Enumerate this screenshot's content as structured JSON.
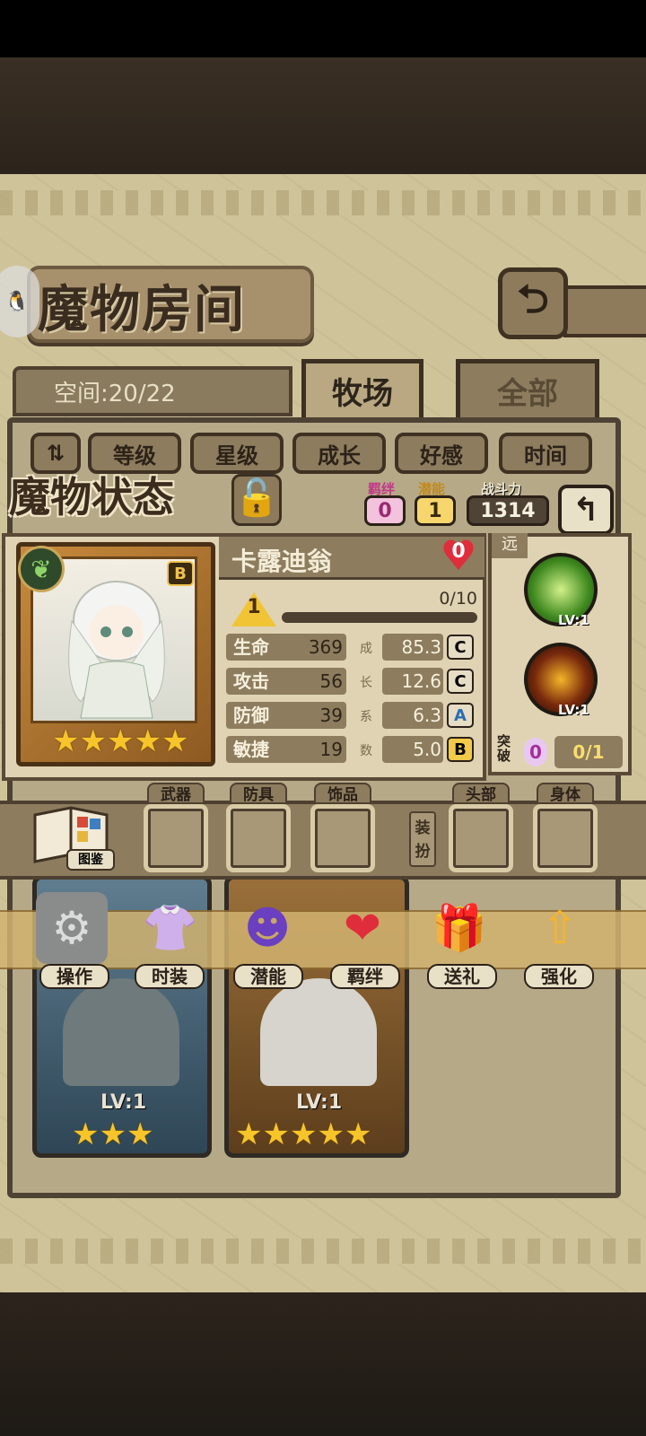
{
  "header": {
    "title": "魔物房间",
    "space": "空间:20/22"
  },
  "tabs": [
    {
      "label": "牧场"
    },
    {
      "label": "全部"
    }
  ],
  "sort": [
    "等级",
    "星级",
    "成长",
    "好感",
    "时间"
  ],
  "status": {
    "title": "魔物状态",
    "bond_label": "羁绊",
    "bond_value": "0",
    "potential_label": "潜能",
    "potential_value": "1",
    "power_label": "战斗力",
    "power_value": "1314"
  },
  "monster": {
    "name": "卡露迪翁",
    "rank": "B",
    "affection": "0",
    "level": "1",
    "exp": "0/10",
    "exp_fraction": 0.0,
    "stars": 5,
    "stats": [
      {
        "label": "生命",
        "value": "369",
        "growth": "85.3",
        "grade": "C"
      },
      {
        "label": "攻击",
        "value": "56",
        "growth": "12.6",
        "grade": "C"
      },
      {
        "label": "防御",
        "value": "39",
        "growth": "6.3",
        "grade": "A"
      },
      {
        "label": "敏捷",
        "value": "19",
        "growth": "5.0",
        "grade": "B"
      }
    ],
    "growth_chars": [
      "成",
      "长",
      "系",
      "数"
    ]
  },
  "skills": {
    "range": "远",
    "list": [
      {
        "level": "LV:1"
      },
      {
        "level": "LV:1"
      }
    ],
    "break_label": "突破",
    "break_value": "0",
    "break_progress": "0/1"
  },
  "equipment": {
    "book_label": "图鉴",
    "slots": [
      "武器",
      "防具",
      "饰品"
    ],
    "dress_label": "装扮",
    "dress_slots": [
      "头部",
      "身体"
    ]
  },
  "actions": [
    "操作",
    "时装",
    "潜能",
    "羁绊",
    "送礼",
    "强化"
  ],
  "list_cards": [
    {
      "level": "LV:1",
      "stars": 3
    },
    {
      "level": "LV:1",
      "stars": 5
    }
  ]
}
